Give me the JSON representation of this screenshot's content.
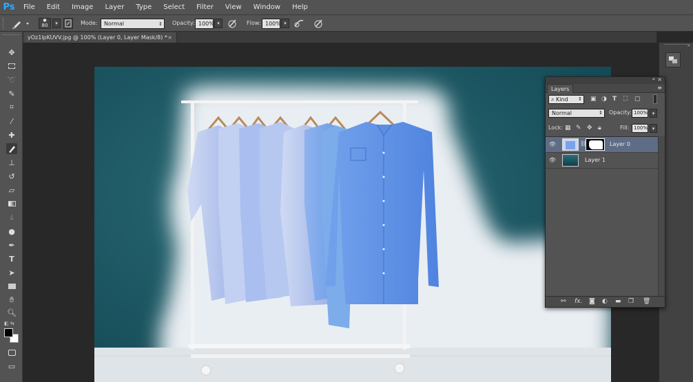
{
  "app": {
    "logo": "Ps"
  },
  "menu": [
    "File",
    "Edit",
    "Image",
    "Layer",
    "Type",
    "Select",
    "Filter",
    "View",
    "Window",
    "Help"
  ],
  "options": {
    "brush_size": "80",
    "mode_label": "Mode:",
    "mode_value": "Normal",
    "opacity_label": "Opacity:",
    "opacity_value": "100%",
    "flow_label": "Flow:",
    "flow_value": "100%"
  },
  "document": {
    "tab_title": "yOz1lpKUVV.jpg @ 100% (Layer 0, Layer Mask/8) *",
    "close_glyph": "×"
  },
  "layers_panel": {
    "title": "Layers",
    "filter_label": "Kind",
    "blend_mode": "Normal",
    "opacity_label": "Opacity:",
    "opacity_value": "100%",
    "lock_label": "Lock:",
    "fill_label": "Fill:",
    "fill_value": "100%",
    "layers": [
      {
        "name": "Layer 0",
        "selected": true
      },
      {
        "name": "Layer 1",
        "selected": false
      }
    ]
  },
  "colors": {
    "ui_dark": "#282828",
    "ui_panel": "#535353",
    "selection": "#5e6c85",
    "teal_wall": "#1d5560",
    "shirt_blue": "#6f9ae6"
  }
}
